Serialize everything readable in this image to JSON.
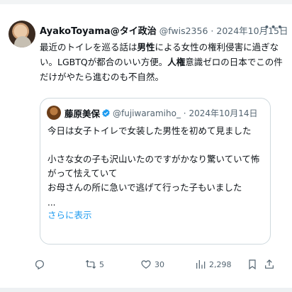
{
  "tweet": {
    "author_name": "AyakoToyama@タイ政治",
    "handle": "@fwis2356",
    "separator": "·",
    "date": "2024年10月15日",
    "more_icon": "more-horizontal-icon",
    "text_segments": [
      {
        "t": "最近のトイレを巡る話は",
        "b": false
      },
      {
        "t": "男性",
        "b": true
      },
      {
        "t": "による女性の権利侵害に過ぎない。LGBTQが都合のいい方便。",
        "b": false
      },
      {
        "t": "人権",
        "b": true
      },
      {
        "t": "意識ゼロの日本でこの件だけがやたら進むのも不自然。",
        "b": false
      }
    ]
  },
  "quote": {
    "author_name": "藤原美保",
    "verified": true,
    "handle": "@fujiwaramiho_",
    "separator": "·",
    "date": "2024年10月14日",
    "line1": "今日は女子トイレで女装した男性を初めて見ました",
    "line2": "小さな女の子も沢山いたのですがかなり驚いていて怖がって怯えていて",
    "line3": "お母さんの所に急いで逃げて行った子もいました",
    "ellipsis": "...",
    "show_more": "さらに表示"
  },
  "actions": {
    "reply_icon": "reply-icon",
    "retweet_icon": "retweet-icon",
    "retweet_count": "5",
    "like_icon": "heart-icon",
    "like_count": "30",
    "views_icon": "views-chart-icon",
    "views_count": "2,298",
    "bookmark_icon": "bookmark-icon",
    "share_icon": "share-icon"
  },
  "colors": {
    "text": "#0f1419",
    "secondary": "#536471",
    "link": "#1d9bf0",
    "border": "#cfd9de"
  }
}
